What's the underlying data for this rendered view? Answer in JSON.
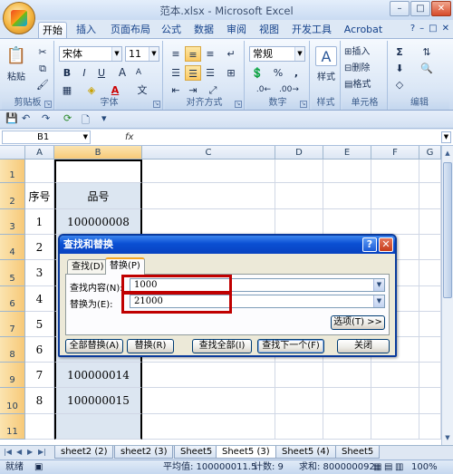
{
  "app": {
    "title": "范本.xlsx - Microsoft Excel",
    "window_buttons": [
      "–",
      "□",
      "✕"
    ]
  },
  "ribbon_tabs": [
    "开始",
    "插入",
    "页面布局",
    "公式",
    "数据",
    "审阅",
    "视图",
    "开发工具",
    "Acrobat"
  ],
  "ribbon_right": [
    "?",
    "–",
    "□",
    "✕"
  ],
  "ribbon": {
    "clipboard": {
      "label": "剪贴板",
      "paste": "粘贴"
    },
    "font": {
      "label": "字体",
      "name": "宋体",
      "size": "11",
      "bold": "B",
      "italic": "I",
      "underline": "U",
      "grow": "A",
      "shrink": "A",
      "wen": "文"
    },
    "alignment": {
      "label": "对齐方式"
    },
    "number": {
      "label": "数字",
      "format": "常规",
      "percent": "%",
      "comma": ","
    },
    "styles": {
      "label": "样式",
      "button": "样式"
    },
    "cells": {
      "label": "单元格",
      "insert": "插入",
      "delete": "删除",
      "format": "格式"
    },
    "editing": {
      "label": "编辑"
    }
  },
  "formula_bar": {
    "name_box": "B1",
    "fx": "fx",
    "value": ""
  },
  "columns": [
    "A",
    "B",
    "C",
    "D",
    "E",
    "F",
    "G"
  ],
  "rows": [
    "1",
    "2",
    "3",
    "4",
    "5",
    "6",
    "7",
    "8",
    "9",
    "10",
    "11"
  ],
  "cells": {
    "a2": "序号",
    "b2": "品号",
    "a3": "1",
    "b3": "100000008",
    "a4": "2",
    "a5": "3",
    "a6": "4",
    "a7": "5",
    "a8": "6",
    "a9": "7",
    "b9": "100000014",
    "a10": "8",
    "b10": "100000015"
  },
  "sheet_tabs": [
    "sheet2 (2)",
    "sheet2 (3)",
    "Sheet5",
    "Sheet5 (3)",
    "Sheet5 (4)",
    "Sheet5"
  ],
  "status": {
    "ready": "就绪",
    "average": "平均值: 100000011.5",
    "count": "计数: 9",
    "sum": "求和: 800000092",
    "zoom": "100%"
  },
  "dialog": {
    "title": "查找和替换",
    "help": "?",
    "close": "✕",
    "tab_find": "查找(D)",
    "tab_replace": "替换(P)",
    "find_label": "查找内容(N):",
    "find_value": "1000",
    "replace_label": "替换为(E):",
    "replace_value": "21000",
    "options": "选项(T) >>",
    "replace_all": "全部替换(A)",
    "replace": "替换(R)",
    "find_all": "查找全部(I)",
    "find_next": "查找下一个(F)",
    "close_btn": "关闭"
  }
}
